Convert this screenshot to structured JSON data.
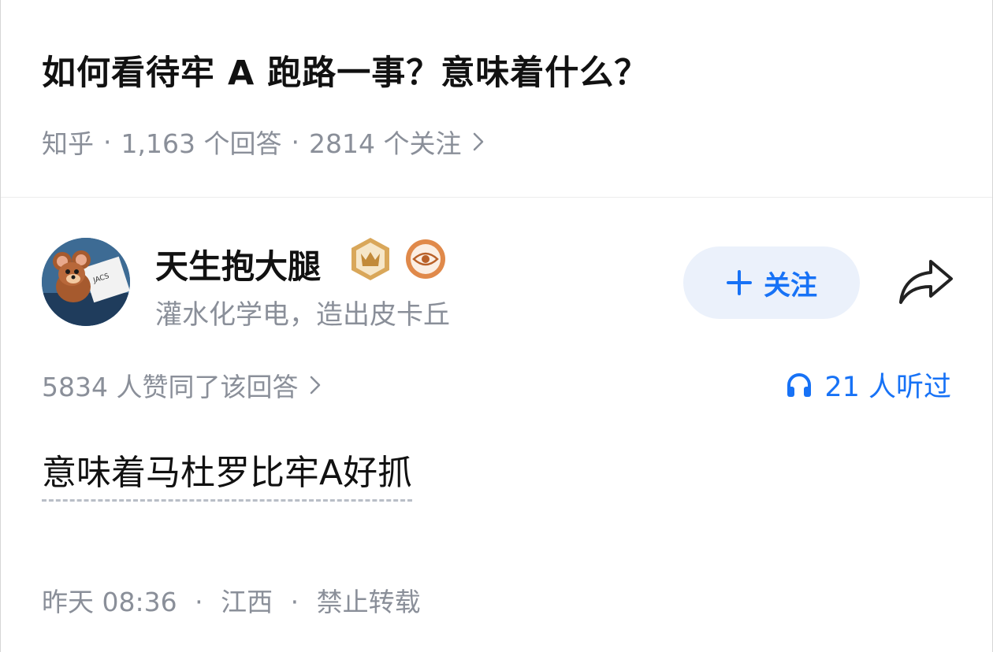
{
  "question": {
    "title": "如何看待牢 A 跑路一事？意味着什么？",
    "source": "知乎",
    "answers": "1,163 个回答",
    "followers": "2814 个关注"
  },
  "author": {
    "name": "天生抱大腿",
    "bio": "灌水化学电，造出皮卡丘",
    "avatar_text": "JACS",
    "follow_label": "关注"
  },
  "stats": {
    "votes": "5834 人赞同了该回答",
    "listened": "21 人听过"
  },
  "answer": {
    "text": "意味着马杜罗比牢A好抓"
  },
  "footer": {
    "time": "昨天 08:36",
    "location": "江西",
    "rights": "禁止转载"
  },
  "colors": {
    "accent": "#1772f6",
    "follow_bg": "#ebf1fb",
    "meta_gray": "#8a8f99",
    "badge_gold": "#d9a75a",
    "badge_orange": "#e0894a"
  },
  "icons": {
    "meta_chevron": "chevron-right-icon",
    "follow": "plus-icon",
    "share": "share-arrow-icon",
    "listened": "headphones-icon",
    "badge1": "crown-badge-icon",
    "badge2": "eye-badge-icon"
  }
}
